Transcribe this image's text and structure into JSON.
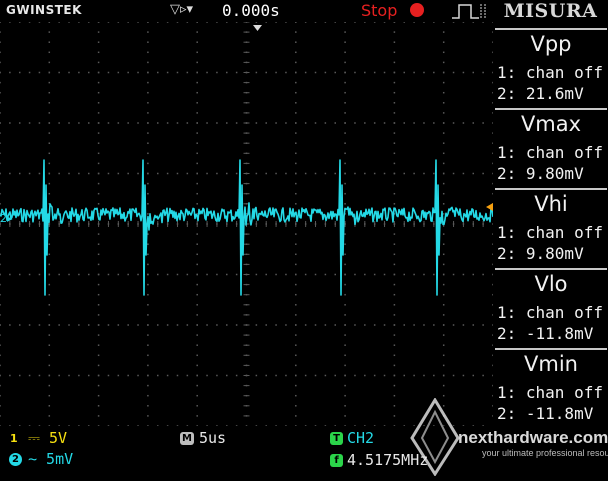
{
  "topbar": {
    "brand": "GWINSTEK",
    "trigger_icons": "▽▹▾",
    "trigger_time": "0.000s",
    "run_state": "Stop",
    "run_state_color": "#e62020"
  },
  "panel": {
    "title": "MISURA",
    "measurements": [
      {
        "name": "Vpp",
        "line1": "1: chan off",
        "line2": "2: 21.6mV"
      },
      {
        "name": "Vmax",
        "line1": "1: chan off",
        "line2": "2: 9.80mV"
      },
      {
        "name": "Vhi",
        "line1": "1: chan off",
        "line2": "2: 9.80mV"
      },
      {
        "name": "Vlo",
        "line1": "1: chan off",
        "line2": "2: -11.8mV"
      },
      {
        "name": "Vmin",
        "line1": "1: chan off",
        "line2": "2: -11.8mV"
      }
    ]
  },
  "bottombar": {
    "ch1_badge": "1",
    "ch1": "⎓ 5V",
    "ch2_badge": "2",
    "ch2": "∼ 5mV",
    "timebase_badge": "M",
    "timebase": "5us",
    "trigger_badge": "T",
    "trigger_source": "CH2",
    "freq_badge": "f",
    "frequency": "4.5175MHz"
  },
  "grid": {
    "ch2_marker": "2▸",
    "colors": {
      "background": "#000000",
      "grid": "#5a5a5a",
      "trace": "#24d9e6",
      "ch1": "#f6e010"
    }
  },
  "watermark": {
    "main": "nexthardware.com",
    "sub": "your ultimate professional resource"
  }
}
